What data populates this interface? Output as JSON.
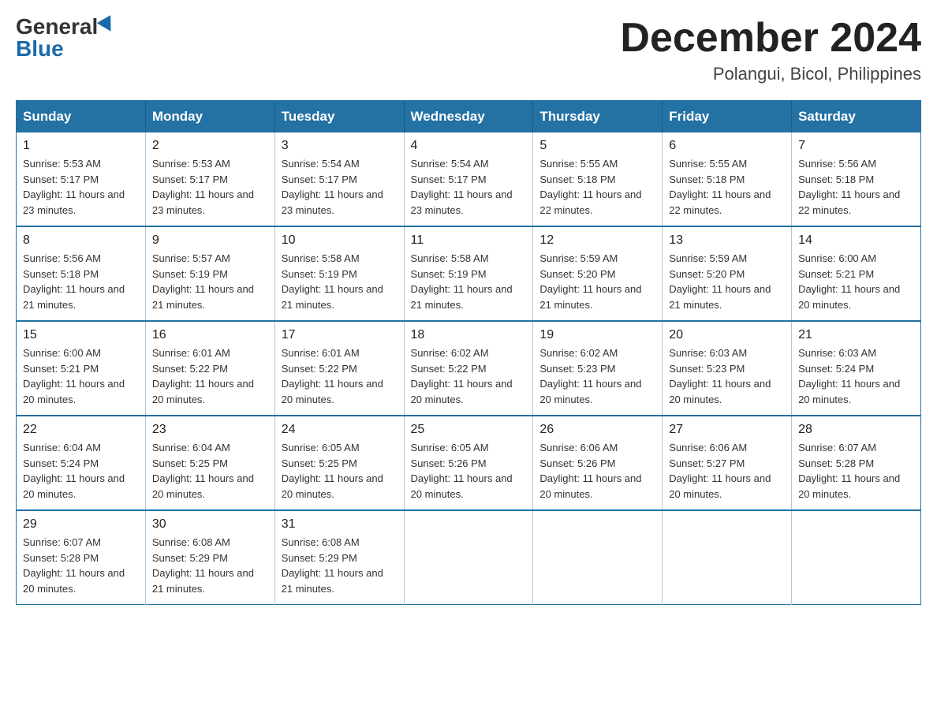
{
  "logo": {
    "general": "General",
    "blue": "Blue"
  },
  "title": {
    "month": "December 2024",
    "location": "Polangui, Bicol, Philippines"
  },
  "headers": [
    "Sunday",
    "Monday",
    "Tuesday",
    "Wednesday",
    "Thursday",
    "Friday",
    "Saturday"
  ],
  "weeks": [
    [
      {
        "day": "1",
        "sunrise": "5:53 AM",
        "sunset": "5:17 PM",
        "daylight": "11 hours and 23 minutes."
      },
      {
        "day": "2",
        "sunrise": "5:53 AM",
        "sunset": "5:17 PM",
        "daylight": "11 hours and 23 minutes."
      },
      {
        "day": "3",
        "sunrise": "5:54 AM",
        "sunset": "5:17 PM",
        "daylight": "11 hours and 23 minutes."
      },
      {
        "day": "4",
        "sunrise": "5:54 AM",
        "sunset": "5:17 PM",
        "daylight": "11 hours and 23 minutes."
      },
      {
        "day": "5",
        "sunrise": "5:55 AM",
        "sunset": "5:18 PM",
        "daylight": "11 hours and 22 minutes."
      },
      {
        "day": "6",
        "sunrise": "5:55 AM",
        "sunset": "5:18 PM",
        "daylight": "11 hours and 22 minutes."
      },
      {
        "day": "7",
        "sunrise": "5:56 AM",
        "sunset": "5:18 PM",
        "daylight": "11 hours and 22 minutes."
      }
    ],
    [
      {
        "day": "8",
        "sunrise": "5:56 AM",
        "sunset": "5:18 PM",
        "daylight": "11 hours and 21 minutes."
      },
      {
        "day": "9",
        "sunrise": "5:57 AM",
        "sunset": "5:19 PM",
        "daylight": "11 hours and 21 minutes."
      },
      {
        "day": "10",
        "sunrise": "5:58 AM",
        "sunset": "5:19 PM",
        "daylight": "11 hours and 21 minutes."
      },
      {
        "day": "11",
        "sunrise": "5:58 AM",
        "sunset": "5:19 PM",
        "daylight": "11 hours and 21 minutes."
      },
      {
        "day": "12",
        "sunrise": "5:59 AM",
        "sunset": "5:20 PM",
        "daylight": "11 hours and 21 minutes."
      },
      {
        "day": "13",
        "sunrise": "5:59 AM",
        "sunset": "5:20 PM",
        "daylight": "11 hours and 21 minutes."
      },
      {
        "day": "14",
        "sunrise": "6:00 AM",
        "sunset": "5:21 PM",
        "daylight": "11 hours and 20 minutes."
      }
    ],
    [
      {
        "day": "15",
        "sunrise": "6:00 AM",
        "sunset": "5:21 PM",
        "daylight": "11 hours and 20 minutes."
      },
      {
        "day": "16",
        "sunrise": "6:01 AM",
        "sunset": "5:22 PM",
        "daylight": "11 hours and 20 minutes."
      },
      {
        "day": "17",
        "sunrise": "6:01 AM",
        "sunset": "5:22 PM",
        "daylight": "11 hours and 20 minutes."
      },
      {
        "day": "18",
        "sunrise": "6:02 AM",
        "sunset": "5:22 PM",
        "daylight": "11 hours and 20 minutes."
      },
      {
        "day": "19",
        "sunrise": "6:02 AM",
        "sunset": "5:23 PM",
        "daylight": "11 hours and 20 minutes."
      },
      {
        "day": "20",
        "sunrise": "6:03 AM",
        "sunset": "5:23 PM",
        "daylight": "11 hours and 20 minutes."
      },
      {
        "day": "21",
        "sunrise": "6:03 AM",
        "sunset": "5:24 PM",
        "daylight": "11 hours and 20 minutes."
      }
    ],
    [
      {
        "day": "22",
        "sunrise": "6:04 AM",
        "sunset": "5:24 PM",
        "daylight": "11 hours and 20 minutes."
      },
      {
        "day": "23",
        "sunrise": "6:04 AM",
        "sunset": "5:25 PM",
        "daylight": "11 hours and 20 minutes."
      },
      {
        "day": "24",
        "sunrise": "6:05 AM",
        "sunset": "5:25 PM",
        "daylight": "11 hours and 20 minutes."
      },
      {
        "day": "25",
        "sunrise": "6:05 AM",
        "sunset": "5:26 PM",
        "daylight": "11 hours and 20 minutes."
      },
      {
        "day": "26",
        "sunrise": "6:06 AM",
        "sunset": "5:26 PM",
        "daylight": "11 hours and 20 minutes."
      },
      {
        "day": "27",
        "sunrise": "6:06 AM",
        "sunset": "5:27 PM",
        "daylight": "11 hours and 20 minutes."
      },
      {
        "day": "28",
        "sunrise": "6:07 AM",
        "sunset": "5:28 PM",
        "daylight": "11 hours and 20 minutes."
      }
    ],
    [
      {
        "day": "29",
        "sunrise": "6:07 AM",
        "sunset": "5:28 PM",
        "daylight": "11 hours and 20 minutes."
      },
      {
        "day": "30",
        "sunrise": "6:08 AM",
        "sunset": "5:29 PM",
        "daylight": "11 hours and 21 minutes."
      },
      {
        "day": "31",
        "sunrise": "6:08 AM",
        "sunset": "5:29 PM",
        "daylight": "11 hours and 21 minutes."
      },
      null,
      null,
      null,
      null
    ]
  ]
}
